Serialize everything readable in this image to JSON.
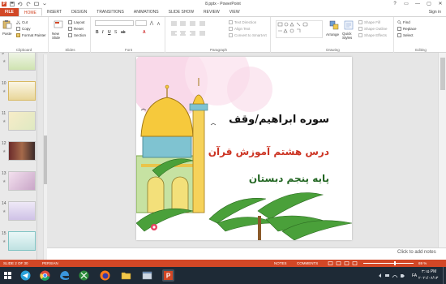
{
  "window": {
    "title": "8.pptx - PowerPoint",
    "controls": [
      "?",
      "▭",
      "—",
      "▢",
      "✕"
    ]
  },
  "tabs": [
    "FILE",
    "HOME",
    "INSERT",
    "DESIGN",
    "TRANSITIONS",
    "ANIMATIONS",
    "SLIDE SHOW",
    "REVIEW",
    "VIEW"
  ],
  "account": "Sign in",
  "ribbon": {
    "clipboard": {
      "paste": "Paste",
      "cut": "Cut",
      "copy": "Copy",
      "format_painter": "Format Painter",
      "label": "Clipboard"
    },
    "slides": {
      "new_slide": "New Slide",
      "layout": "Layout",
      "reset": "Reset",
      "section": "Section",
      "label": "Slides"
    },
    "font": {
      "label": "Font"
    },
    "paragraph": {
      "text_direction": "Text Direction",
      "align_text": "Align Text",
      "convert_smartart": "Convert to SmartArt",
      "label": "Paragraph"
    },
    "drawing": {
      "arrange": "Arrange",
      "quick_styles": "Quick Styles",
      "shape_fill": "Shape Fill",
      "shape_outline": "Shape Outline",
      "shape_effects": "Shape Effects",
      "label": "Drawing"
    },
    "editing": {
      "find": "Find",
      "replace": "Replace",
      "select": "Select",
      "label": "Editing"
    }
  },
  "thumbnails": [
    {
      "num": "9"
    },
    {
      "num": "10"
    },
    {
      "num": "11"
    },
    {
      "num": "12"
    },
    {
      "num": "13"
    },
    {
      "num": "14"
    },
    {
      "num": "15"
    }
  ],
  "slide": {
    "line1": "سوره ابراهیم/وقف",
    "line2": "درس هشتم آموزش قرآن",
    "line3": "پایه پنجم دبستان"
  },
  "notes_placeholder": "Click to add notes",
  "status": {
    "slide_of": "SLIDE 2 OF 30",
    "language": "PERSIAN",
    "notes": "NOTES",
    "comments": "COMMENTS",
    "zoom": "69 %"
  },
  "taskbar": {
    "lang": "FA",
    "time": "۳:۱۵ PM",
    "date": "۲۰۲۱/۰۶/۱۳"
  },
  "colors": {
    "accent": "#d24726",
    "taskbar": "#1e2a36"
  }
}
